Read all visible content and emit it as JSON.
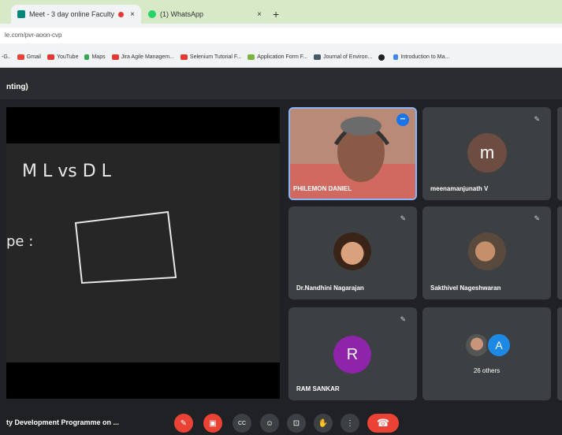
{
  "browser": {
    "tabs": [
      {
        "label": "Meet - 3 day online Faculty",
        "close": "×"
      },
      {
        "label": "(1) WhatsApp",
        "close": "×"
      }
    ],
    "new_tab": "+",
    "url": "le.com/pvr-aoon-cvp"
  },
  "bookmarks": [
    {
      "label": "-G.."
    },
    {
      "label": "Gmail"
    },
    {
      "label": "YouTube"
    },
    {
      "label": "Maps"
    },
    {
      "label": "Jira Agile Managem..."
    },
    {
      "label": "Selenium Tutorial F..."
    },
    {
      "label": "Application Form F..."
    },
    {
      "label": "Journal of Environ..."
    },
    {
      "label": ""
    },
    {
      "label": "Introduction to Ma..."
    }
  ],
  "meet": {
    "header_title": "nting)",
    "board": {
      "title": "M L vs D L",
      "left_text": "pe :"
    },
    "participants": [
      {
        "name": "PHILEMON DANIEL",
        "kind": "video"
      },
      {
        "name": "meenamanjunath V",
        "initial": "m",
        "avatar_color": "#6d4c41"
      },
      {
        "name": "Dr.Nandhini Nagarajan",
        "kind": "photo"
      },
      {
        "name": "Sakthivel Nageshwaran",
        "kind": "photo"
      },
      {
        "name": "RAM SANKAR",
        "initial": "R",
        "avatar_color": "#8e24aa"
      }
    ],
    "others": {
      "label": "26 others",
      "initial": "A",
      "avatar_color": "#1e88e5"
    },
    "meeting_name": "ty Development Programme on ...",
    "mic_off_glyph": "✎",
    "controls": {
      "mic": "✎",
      "camera": "▣",
      "cc": "CC",
      "emoji": "☺",
      "present": "⊡",
      "hand": "✋",
      "more": "⋮",
      "hangup": "☎"
    },
    "more_dots": "•••"
  },
  "colors": {
    "tabbar": "#d8e9c8",
    "danger": "#ea4335",
    "tile": "#3c4043",
    "accent": "#8ab4f8"
  }
}
